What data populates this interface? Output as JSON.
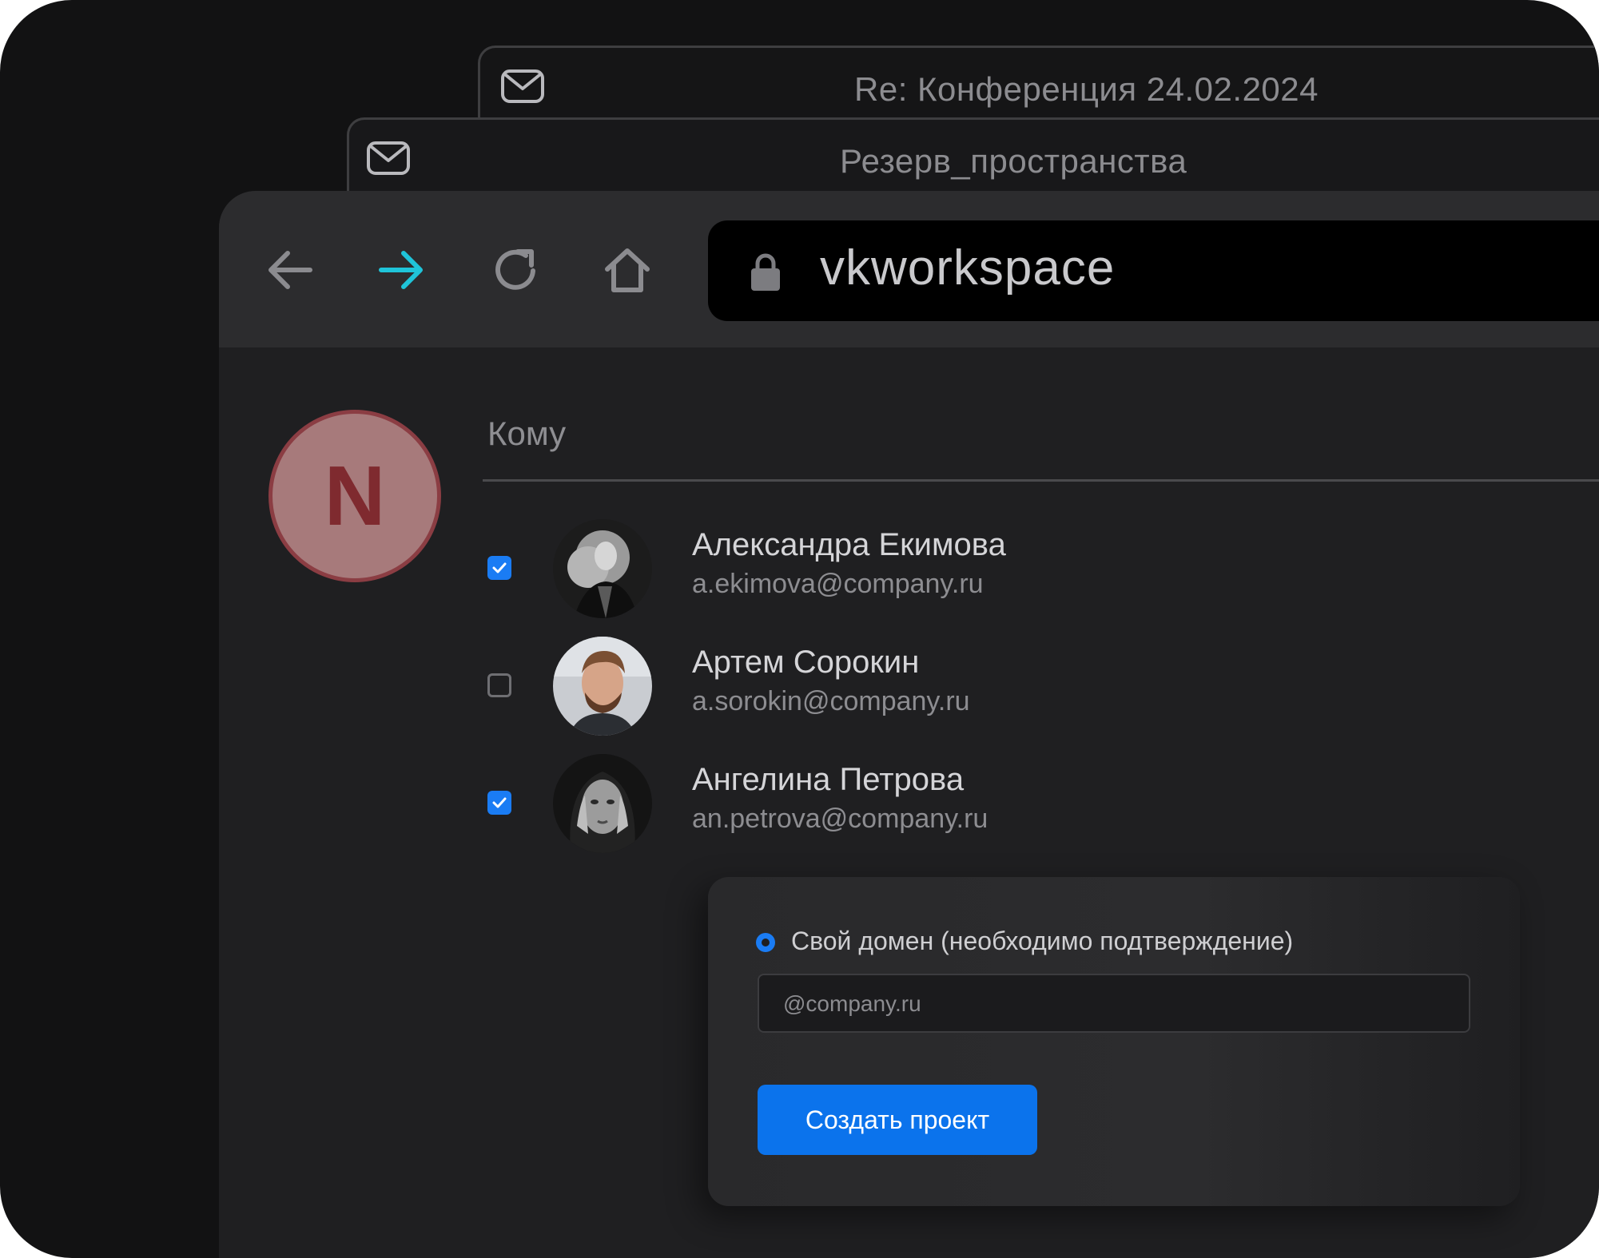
{
  "background_windows": [
    {
      "title": "Re: Конференция 24.02.2024",
      "icon": "mail-icon"
    },
    {
      "title": "Резерв_пространства",
      "icon": "mail-icon"
    }
  ],
  "browser": {
    "nav": {
      "back_icon": "arrow-left-icon",
      "forward_icon": "arrow-right-icon",
      "reload_icon": "reload-icon",
      "home_icon": "home-icon"
    },
    "address_bar": {
      "lock_icon": "lock-icon",
      "url": "vkworkspace"
    },
    "accent_color": "#1fc4d9"
  },
  "compose": {
    "sender_initial": "N",
    "to_label": "Кому",
    "recipients": [
      {
        "name": "Александра Екимова",
        "email": "a.ekimova@company.ru",
        "checked": true
      },
      {
        "name": "Артем Сорокин",
        "email": "a.sorokin@company.ru",
        "checked": false
      },
      {
        "name": "Ангелина Петрова",
        "email": "an.petrova@company.ru",
        "checked": true
      }
    ]
  },
  "domain_card": {
    "radio_label": "Свой домен (необходимо подтверждение)",
    "domain_value": "@company.ru",
    "create_button": "Создать проект"
  },
  "colors": {
    "primary_blue": "#0b73ec",
    "checkbox_blue": "#1a7cf4",
    "avatar_bg": "#a77a7b",
    "avatar_border": "#8b3d43"
  }
}
